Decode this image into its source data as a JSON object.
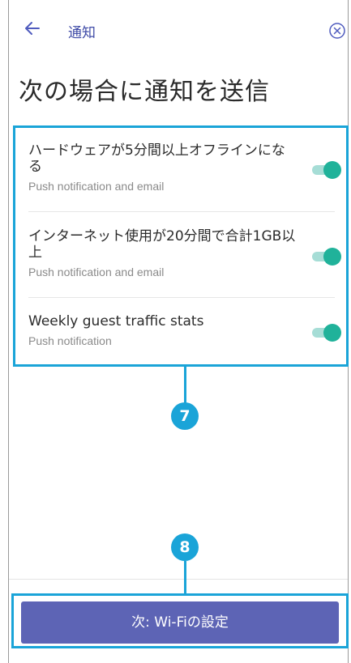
{
  "header": {
    "back_icon": "arrow-left-icon",
    "title": "通知",
    "close_icon": "circle-x-icon"
  },
  "page": {
    "heading": "次の場合に通知を送信"
  },
  "notifications": [
    {
      "title": "ハードウェアが5分間以上オフラインになる",
      "subtitle": "Push notification and email",
      "enabled": true
    },
    {
      "title": "インターネット使用が20分間で合計1GB以上",
      "subtitle": "Push notification and email",
      "enabled": true
    },
    {
      "title": "Weekly guest traffic stats",
      "subtitle": "Push notification",
      "enabled": true
    }
  ],
  "callouts": {
    "list": "7",
    "button": "8"
  },
  "footer": {
    "next_label": "次: Wi-Fiの設定"
  },
  "colors": {
    "accent": "#1aa4d8",
    "toggle_on": "#20b29a",
    "button": "#5d64b5"
  }
}
